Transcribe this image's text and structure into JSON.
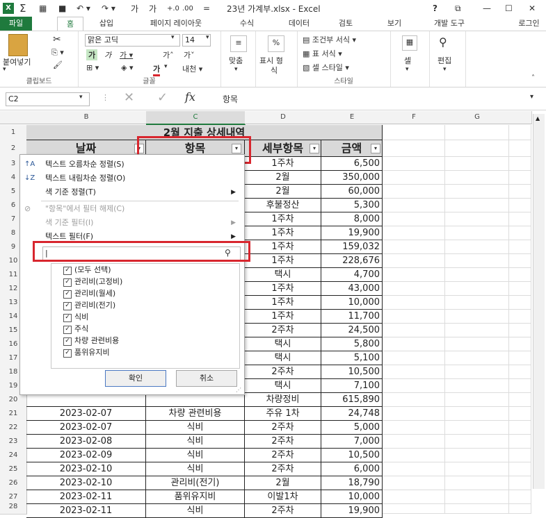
{
  "titlebar": {
    "app_icon": "excel-icon",
    "title": "23년 가계부.xlsx - Excel",
    "help": "?",
    "minimize": "—",
    "maximize": "☐",
    "close": "✕"
  },
  "tabs": {
    "file": "파일",
    "home": "홈",
    "insert": "삽입",
    "layout": "페이지 레이아웃",
    "formulas": "수식",
    "data": "데이터",
    "review": "검토",
    "view": "보기",
    "developer": "개발 도구",
    "login": "로그인"
  },
  "ribbon": {
    "paste_label": "붙여넣기",
    "clipboard_group": "클립보드",
    "font_name": "맑은 고딕",
    "font_size": "14",
    "font_group": "글꼴",
    "align_label": "맞춤",
    "number_label_1": "표시 형",
    "number_label_2": "식",
    "percent_symbol": "%",
    "cond_format": "조건부 서식",
    "table_format": "표 서식",
    "cell_style": "셀 스타일",
    "style_group": "스타일",
    "cell_label": "셀",
    "edit_label": "편집"
  },
  "formula_bar": {
    "name_box": "C2",
    "fx": "fx",
    "value": "항목"
  },
  "columns": [
    "B",
    "C",
    "D",
    "E",
    "F",
    "G"
  ],
  "rows": [
    "1",
    "2",
    "3",
    "4",
    "5",
    "6",
    "7",
    "8",
    "9",
    "10",
    "11",
    "12",
    "13",
    "14",
    "15",
    "16",
    "17",
    "18",
    "19",
    "20",
    "21",
    "22",
    "23",
    "24",
    "25",
    "26",
    "27",
    "28"
  ],
  "sheet": {
    "title": "2월 지출 상세내역",
    "headers": {
      "date": "날짜",
      "item": "항목",
      "detail": "세부항목",
      "amount": "금액"
    },
    "visible_rows": [
      {
        "detail": "1주차",
        "amount": "6,500"
      },
      {
        "detail": "2월",
        "amount": "350,000"
      },
      {
        "detail": "2월",
        "amount": "60,000"
      },
      {
        "detail": "후불정산",
        "amount": "5,300"
      },
      {
        "detail": "1주차",
        "amount": "8,000"
      },
      {
        "detail": "1주차",
        "amount": "19,900"
      },
      {
        "detail": "1주차",
        "amount": "159,032"
      },
      {
        "detail": "1주차",
        "amount": "228,676"
      },
      {
        "detail": "택시",
        "amount": "4,700"
      },
      {
        "detail": "1주차",
        "amount": "43,000"
      },
      {
        "detail": "1주차",
        "amount": "10,000"
      },
      {
        "detail": "1주차",
        "amount": "11,700"
      },
      {
        "detail": "2주차",
        "amount": "24,500"
      },
      {
        "detail": "택시",
        "amount": "5,800"
      },
      {
        "detail": "택시",
        "amount": "5,100"
      },
      {
        "detail": "2주차",
        "amount": "10,500"
      },
      {
        "detail": "택시",
        "amount": "7,100"
      },
      {
        "detail": "차량정비",
        "amount": "615,890"
      }
    ],
    "full_rows": [
      {
        "date": "2023-02-07",
        "item": "차량 관련비용",
        "detail": "주유 1차",
        "amount": "24,748"
      },
      {
        "date": "2023-02-07",
        "item": "식비",
        "detail": "2주차",
        "amount": "5,000"
      },
      {
        "date": "2023-02-08",
        "item": "식비",
        "detail": "2주차",
        "amount": "7,000"
      },
      {
        "date": "2023-02-09",
        "item": "식비",
        "detail": "2주차",
        "amount": "10,500"
      },
      {
        "date": "2023-02-10",
        "item": "식비",
        "detail": "2주차",
        "amount": "6,000"
      },
      {
        "date": "2023-02-10",
        "item": "관리비(전기)",
        "detail": "2월",
        "amount": "18,790"
      },
      {
        "date": "2023-02-11",
        "item": "품위유지비",
        "detail": "이발1차",
        "amount": "10,000"
      },
      {
        "date": "2023-02-11",
        "item": "식비",
        "detail": "2주차",
        "amount": "19,900"
      }
    ]
  },
  "filter_menu": {
    "sort_asc": "텍스트 오름차순 정렬(S)",
    "sort_desc": "텍스트 내림차순 정렬(O)",
    "sort_color": "색 기준 정렬(T)",
    "clear_filter": "\"항목\"에서 필터 해제(C)",
    "color_filter": "색 기준 필터(I)",
    "text_filter": "텍스트 필터(F)",
    "search_placeholder": "",
    "items": [
      "(모두 선택)",
      "관리비(고정비)",
      "관리비(월세)",
      "관리비(전기)",
      "식비",
      "주식",
      "차량 관련비용",
      "품위유지비"
    ],
    "ok": "확인",
    "cancel": "취소"
  }
}
